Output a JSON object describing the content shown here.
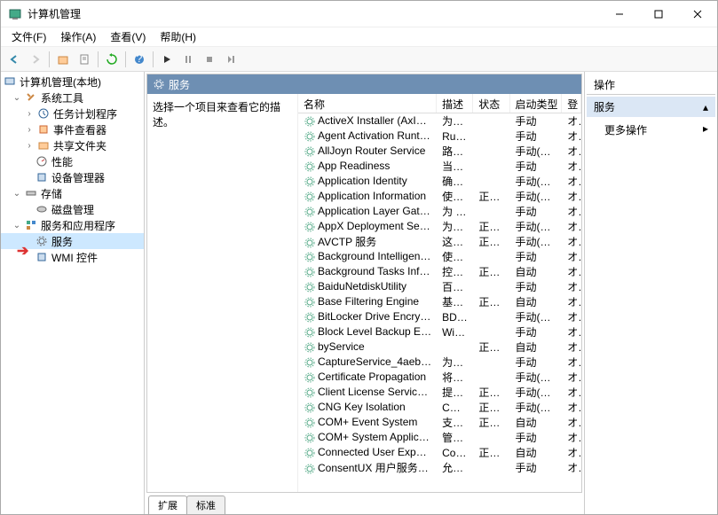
{
  "window": {
    "title": "计算机管理"
  },
  "menu": {
    "file": "文件(F)",
    "action": "操作(A)",
    "view": "查看(V)",
    "help": "帮助(H)"
  },
  "tree": {
    "root": "计算机管理(本地)",
    "sys_tools": "系统工具",
    "task_sched": "任务计划程序",
    "event_viewer": "事件查看器",
    "shared": "共享文件夹",
    "perf": "性能",
    "devmgr": "设备管理器",
    "storage": "存储",
    "diskmgr": "磁盘管理",
    "svcapps": "服务和应用程序",
    "services": "服务",
    "wmi": "WMI 控件"
  },
  "center": {
    "header": "服务",
    "desc_prompt": "选择一个项目来查看它的描述。",
    "cols": {
      "name": "名称",
      "desc": "描述",
      "state": "状态",
      "start": "启动类型",
      "logon": "登"
    },
    "tabs": {
      "ext": "扩展",
      "std": "标准"
    }
  },
  "actions": {
    "header": "操作",
    "sub": "服务",
    "more": "更多操作"
  },
  "truncated": "オ",
  "services": [
    {
      "name": "ActiveX Installer (AxInstSV)",
      "desc": "为从...",
      "state": "",
      "start": "手动"
    },
    {
      "name": "Agent Activation Runtime_...",
      "desc": "Runt...",
      "state": "",
      "start": "手动"
    },
    {
      "name": "AllJoyn Router Service",
      "desc": "路由...",
      "state": "",
      "start": "手动(触发..."
    },
    {
      "name": "App Readiness",
      "desc": "当用...",
      "state": "",
      "start": "手动"
    },
    {
      "name": "Application Identity",
      "desc": "确定...",
      "state": "",
      "start": "手动(触发..."
    },
    {
      "name": "Application Information",
      "desc": "使用...",
      "state": "正在...",
      "start": "手动(触发..."
    },
    {
      "name": "Application Layer Gateway ...",
      "desc": "为 In...",
      "state": "",
      "start": "手动"
    },
    {
      "name": "AppX Deployment Service ...",
      "desc": "为部...",
      "state": "正在...",
      "start": "手动(触发..."
    },
    {
      "name": "AVCTP 服务",
      "desc": "这是...",
      "state": "正在...",
      "start": "手动(触发..."
    },
    {
      "name": "Background Intelligent Tra...",
      "desc": "使用...",
      "state": "",
      "start": "手动"
    },
    {
      "name": "Background Tasks Infrastru...",
      "desc": "控制...",
      "state": "正在...",
      "start": "自动"
    },
    {
      "name": "BaiduNetdiskUtility",
      "desc": "百度...",
      "state": "",
      "start": "手动"
    },
    {
      "name": "Base Filtering Engine",
      "desc": "基本...",
      "state": "正在...",
      "start": "自动"
    },
    {
      "name": "BitLocker Drive Encryption ...",
      "desc": "BDE...",
      "state": "",
      "start": "手动(触发..."
    },
    {
      "name": "Block Level Backup Engine ...",
      "desc": "Win...",
      "state": "",
      "start": "手动"
    },
    {
      "name": "byService",
      "desc": "",
      "state": "正在...",
      "start": "自动"
    },
    {
      "name": "CaptureService_4aeb7ca",
      "desc": "为调...",
      "state": "",
      "start": "手动"
    },
    {
      "name": "Certificate Propagation",
      "desc": "将用...",
      "state": "",
      "start": "手动(触发..."
    },
    {
      "name": "Client License Service (Clip...",
      "desc": "提供...",
      "state": "正在...",
      "start": "手动(触发..."
    },
    {
      "name": "CNG Key Isolation",
      "desc": "CNG...",
      "state": "正在...",
      "start": "手动(触发..."
    },
    {
      "name": "COM+ Event System",
      "desc": "支持...",
      "state": "正在...",
      "start": "自动"
    },
    {
      "name": "COM+ System Application",
      "desc": "管理...",
      "state": "",
      "start": "手动"
    },
    {
      "name": "Connected User Experienc...",
      "desc": "Con...",
      "state": "正在...",
      "start": "自动"
    },
    {
      "name": "ConsentUX 用户服务_4aeb...",
      "desc": "允许...",
      "state": "",
      "start": "手动"
    }
  ]
}
